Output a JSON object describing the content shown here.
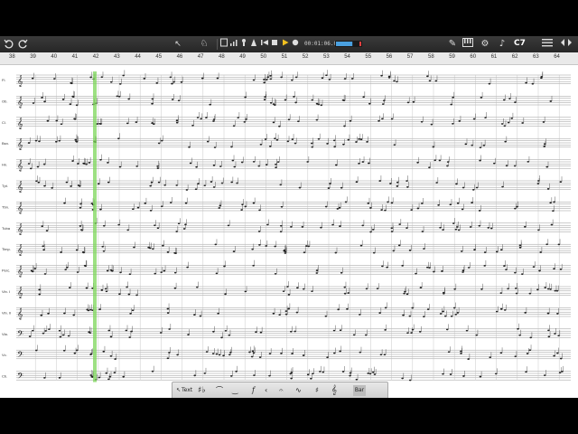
{
  "toolbar": {
    "undo_icon": "undo-icon",
    "redo_icon": "redo-icon",
    "time": "00:01:06.08",
    "chord": "C7",
    "level_meter": 0.7
  },
  "measures": [
    "38",
    "39",
    "40",
    "41",
    "42",
    "43",
    "44",
    "45",
    "46",
    "47",
    "48",
    "49",
    "50",
    "51",
    "52",
    "53",
    "54",
    "55",
    "56",
    "57",
    "58",
    "59",
    "60",
    "61",
    "62",
    "63",
    "64"
  ],
  "instruments": [
    "Fl.",
    "Ob.",
    "Cl.",
    "Bsn.",
    "Hn.",
    "Tpt.",
    "Tbn.",
    "Tuba",
    "Timp.",
    "Perc.",
    "Vln. I",
    "Vln. II",
    "Vla.",
    "Vc.",
    "Cb."
  ],
  "palette": {
    "text_label": "Text",
    "sharp_flat": "♯♭",
    "clef": "𝄞",
    "more_label": "Bar",
    "tempo_label": "f"
  },
  "colors": {
    "toolbar_bg": "#2e2e2e",
    "playback_cursor": "#7cd65a",
    "accent": "#f0c020",
    "meter": "#4aa0e0"
  }
}
